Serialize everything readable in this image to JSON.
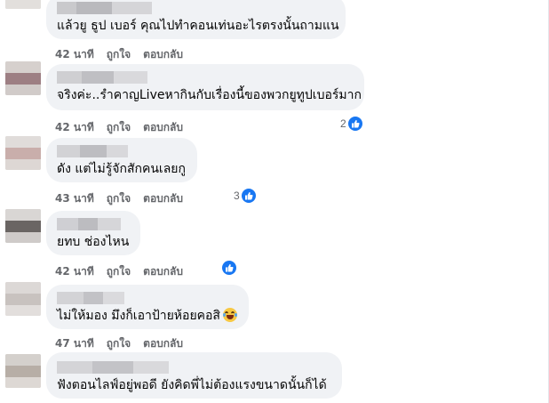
{
  "colors": {
    "bubble": "#f0f2f5",
    "meta_text": "#65676b",
    "like_blue": "#1877f2"
  },
  "comments": [
    {
      "text": "แล้วยู ธูป เบอร์ คุณไปทำคอนเท่นอะไรตรงนั้นถามแน",
      "time": "42 นาที",
      "like": "ถูกใจ",
      "reply": "ตอบกลับ",
      "reaction_count": ""
    },
    {
      "text": "จริงค่ะ..รำคาญLiveหากินกับเรื่องนี้ของพวกยูทูปเบอร์มาก",
      "time": "42 นาที",
      "like": "ถูกใจ",
      "reply": "ตอบกลับ",
      "reaction_count": "2"
    },
    {
      "text": "ดัง แต่ไม่รู้จักสักคนเลยกู",
      "time": "43 นาที",
      "like": "ถูกใจ",
      "reply": "ตอบกลับ",
      "reaction_count": "3"
    },
    {
      "text": "ยทบ ช่องไหน",
      "time": "42 นาที",
      "like": "ถูกใจ",
      "reply": "ตอบกลับ",
      "reaction_count": ""
    },
    {
      "text": "ไม่ให้มอง มึงก็เอาป้ายห้อยคอสิ",
      "time": "47 นาที",
      "like": "ถูกใจ",
      "reply": "ตอบกลับ",
      "reaction_count": "",
      "emoji": "laughing-tears-emoji"
    },
    {
      "text": "ฟังตอนไลฟ์อยู่พอดี ยังคิดพี่ไม่ต้องแรงขนาดนั้นก็ได้",
      "time": "",
      "like": "",
      "reply": "",
      "reaction_count": ""
    }
  ]
}
